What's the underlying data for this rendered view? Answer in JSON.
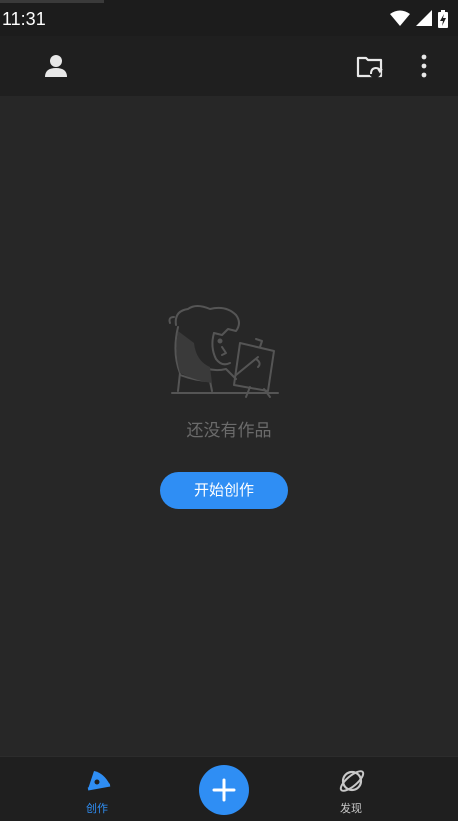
{
  "status_bar": {
    "time": "11:31",
    "icons": [
      "wifi-icon",
      "cellular-signal-icon",
      "battery-icon"
    ]
  },
  "app_bar": {
    "left_icon": "profile-icon",
    "right_icons": [
      "cloud-folder-sync-icon",
      "more-vertical-icon"
    ]
  },
  "empty_state": {
    "illustration": "artist-at-easel-illustration",
    "message": "还没有作品",
    "button_label": "开始创作"
  },
  "bottom_nav": {
    "tabs": [
      {
        "label": "创作",
        "icon": "pen-create-icon",
        "selected": true
      },
      {
        "label": "发现",
        "icon": "planet-discover-icon",
        "selected": false
      }
    ],
    "fab_icon": "plus-icon"
  },
  "colors": {
    "background": "#272727",
    "bars": "#1f1f1f",
    "accent": "#2f8ef4",
    "muted_text": "#6b6b6b"
  }
}
